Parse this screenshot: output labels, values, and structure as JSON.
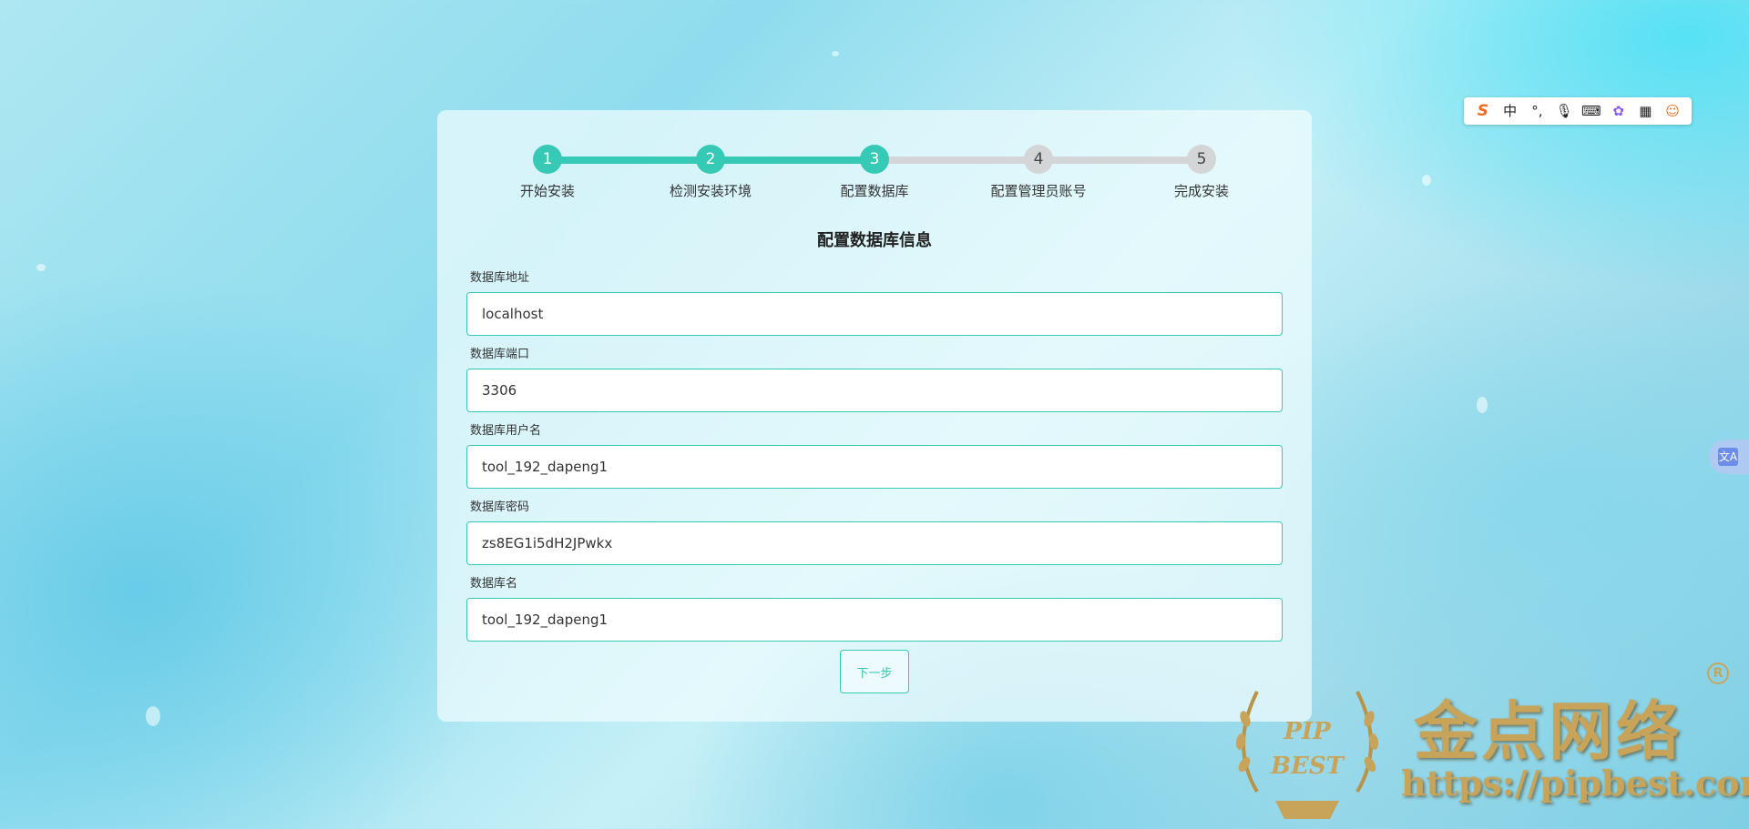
{
  "steps": [
    {
      "number": "1",
      "label": "开始安装",
      "status": "done"
    },
    {
      "number": "2",
      "label": "检测安装环境",
      "status": "done"
    },
    {
      "number": "3",
      "label": "配置数据库",
      "status": "current"
    },
    {
      "number": "4",
      "label": "配置管理员账号",
      "status": "todo"
    },
    {
      "number": "5",
      "label": "完成安装",
      "status": "todo"
    }
  ],
  "form": {
    "title": "配置数据库信息",
    "fields": [
      {
        "label": "数据库地址",
        "value": "localhost"
      },
      {
        "label": "数据库端口",
        "value": "3306"
      },
      {
        "label": "数据库用户名",
        "value": "tool_192_dapeng1"
      },
      {
        "label": "数据库密码",
        "value": "zs8EG1i5dH2JPwkx"
      },
      {
        "label": "数据库名",
        "value": "tool_192_dapeng1"
      }
    ],
    "next_label": "下一步"
  },
  "ime_toolbar": {
    "items": [
      {
        "icon": "sogou-logo-icon",
        "text": "S"
      },
      {
        "icon": "chinese-mode-icon",
        "text": "中"
      },
      {
        "icon": "punctuation-icon",
        "text": "°,"
      },
      {
        "icon": "microphone-icon",
        "text": "🎙"
      },
      {
        "icon": "keyboard-icon",
        "text": "⌨"
      },
      {
        "icon": "skin-icon",
        "text": "✿"
      },
      {
        "icon": "grid-menu-icon",
        "text": "▦"
      },
      {
        "icon": "mascot-icon",
        "text": "☺"
      }
    ]
  },
  "translate_button": {
    "icon": "translate-icon",
    "text": "文A"
  },
  "watermark": {
    "emblem_lines": [
      "PIP",
      "BEST"
    ],
    "title": "金点网络",
    "url": "https://pipbest.com",
    "registered": "R"
  },
  "colors": {
    "accent": "#36c9b5",
    "inactive": "#d3d5d7",
    "watermark_gold": "#c8a45a",
    "ime_logo": "#f26b1d"
  }
}
